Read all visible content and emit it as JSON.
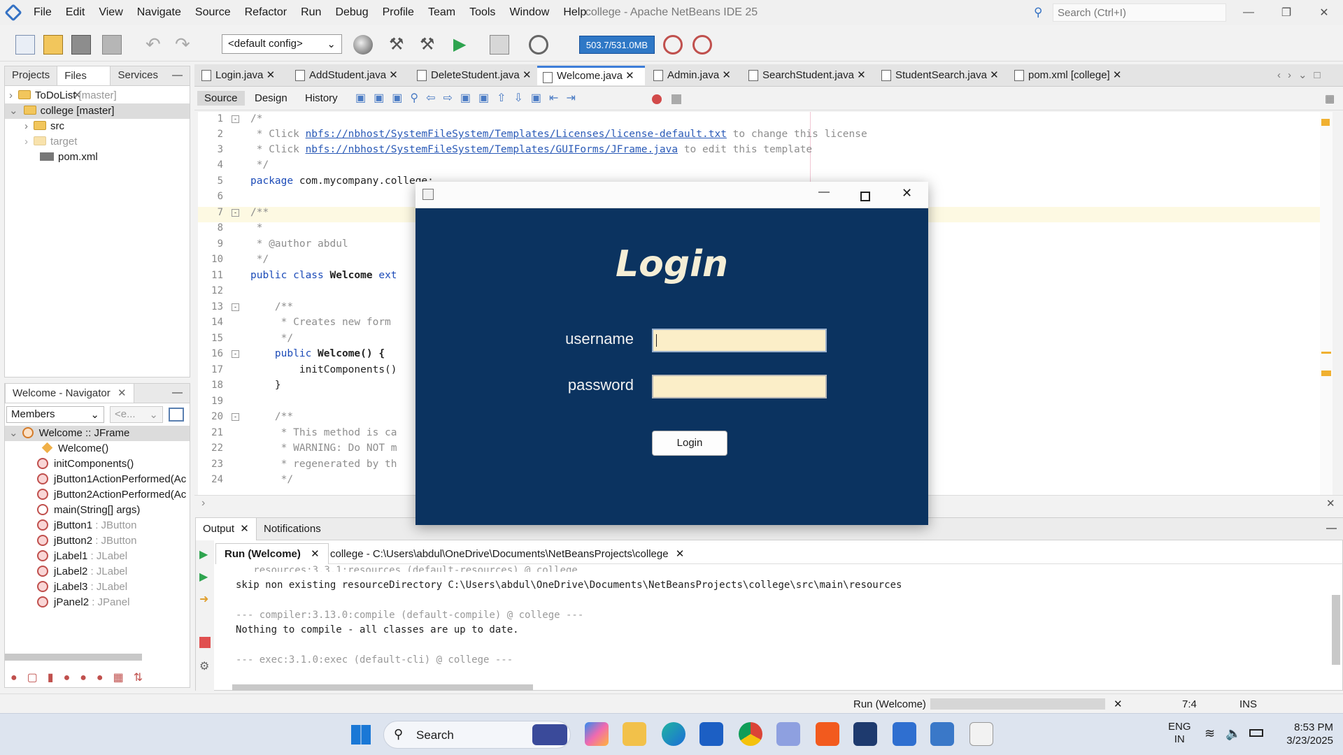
{
  "window": {
    "title": "college - Apache NetBeans IDE 25",
    "search_placeholder": "Search (Ctrl+I)",
    "menu": [
      "File",
      "Edit",
      "View",
      "Navigate",
      "Source",
      "Refactor",
      "Run",
      "Debug",
      "Profile",
      "Team",
      "Tools",
      "Window",
      "Help"
    ]
  },
  "toolbar": {
    "config": "<default config>",
    "memory": "503.7/531.0MB"
  },
  "projects_panel": {
    "tabs": [
      "Projects",
      "Files",
      "Services"
    ],
    "active_tab": "Files",
    "items": [
      {
        "label": "ToDoList",
        "tag": "[master]"
      },
      {
        "label": "college [master]",
        "tag": ""
      },
      {
        "label": "src",
        "tag": ""
      },
      {
        "label": "target",
        "tag": ""
      },
      {
        "label": "pom.xml",
        "tag": ""
      }
    ]
  },
  "navigator": {
    "title": "Welcome - Navigator",
    "filter": "Members",
    "filter2": "<e...",
    "root": "Welcome :: JFrame",
    "members": [
      {
        "name": "Welcome()",
        "type": ""
      },
      {
        "name": "initComponents()",
        "type": ""
      },
      {
        "name": "jButton1ActionPerformed(Ac",
        "type": ""
      },
      {
        "name": "jButton2ActionPerformed(Ac",
        "type": ""
      },
      {
        "name": "main(String[] args)",
        "type": ""
      },
      {
        "name": "jButton1",
        "type": " : JButton"
      },
      {
        "name": "jButton2",
        "type": " : JButton"
      },
      {
        "name": "jLabel1",
        "type": " : JLabel"
      },
      {
        "name": "jLabel2",
        "type": " : JLabel"
      },
      {
        "name": "jLabel3",
        "type": " : JLabel"
      },
      {
        "name": "jPanel2",
        "type": " : JPanel"
      }
    ]
  },
  "editor": {
    "tabs": [
      "Login.java",
      "AddStudent.java",
      "DeleteStudent.java",
      "Welcome.java",
      "Admin.java",
      "SearchStudent.java",
      "StudentSearch.java",
      "pom.xml [college]"
    ],
    "active_tab": "Welcome.java",
    "views": [
      "Source",
      "Design",
      "History"
    ],
    "line_numbers": [
      "1",
      "2",
      "3",
      "4",
      "5",
      "6",
      "7",
      "8",
      "9",
      "10",
      "11",
      "12",
      "13",
      "14",
      "15",
      "16",
      "17",
      "18",
      "19",
      "20",
      "21",
      "22",
      "23",
      "24"
    ],
    "lines": {
      "l1": "/*",
      "l2a": " * Click ",
      "l2b": "nbfs://nbhost/SystemFileSystem/Templates/Licenses/license-default.txt",
      "l2c": " to change this license",
      "l3a": " * Click ",
      "l3b": "nbfs://nbhost/SystemFileSystem/Templates/GUIForms/JFrame.java",
      "l3c": " to edit this template",
      "l4": " */",
      "l5a": "package",
      "l5b": " com.mycompany.college;",
      "l7": "/**",
      "l8": " *",
      "l9": " * @author abdul",
      "l10": " */",
      "l11a": "public class",
      "l11b": " Welcome",
      "l11c": " ext",
      "l13": "    /**",
      "l14": "     * Creates new form",
      "l15": "     */",
      "l16a": "    public",
      "l16b": " Welcome() {",
      "l17": "        initComponents()",
      "l18": "    }",
      "l20": "    /**",
      "l21": "     * This method is ca",
      "l22": "     * WARNING: Do NOT m",
      "l23": "     * regenerated by th",
      "l24": "     */"
    }
  },
  "login_dialog": {
    "title": "Login",
    "username_label": "username",
    "password_label": "password",
    "button": "Login"
  },
  "output": {
    "tabs": [
      "Output",
      "Notifications"
    ],
    "run_tabs": [
      "Run (Welcome)",
      "college - C:\\Users\\abdul\\OneDrive\\Documents\\NetBeansProjects\\college"
    ],
    "lines": [
      "skip non existing resourceDirectory C:\\Users\\abdul\\OneDrive\\Documents\\NetBeansProjects\\college\\src\\main\\resources",
      "",
      "--- compiler:3.13.0:compile (default-compile) @ college ---",
      "Nothing to compile - all classes are up to date.",
      "",
      "--- exec:3.1.0:exec (default-cli) @ college ---"
    ],
    "partial_top": "   resources:3.3.1:resources (default-resources) @ college"
  },
  "statusbar": {
    "task": "Run (Welcome)",
    "position": "7:4",
    "mode": "INS"
  },
  "taskbar": {
    "search": "Search",
    "lang1": "ENG",
    "lang2": "IN",
    "time": "8:53 PM",
    "date": "3/23/2025"
  }
}
